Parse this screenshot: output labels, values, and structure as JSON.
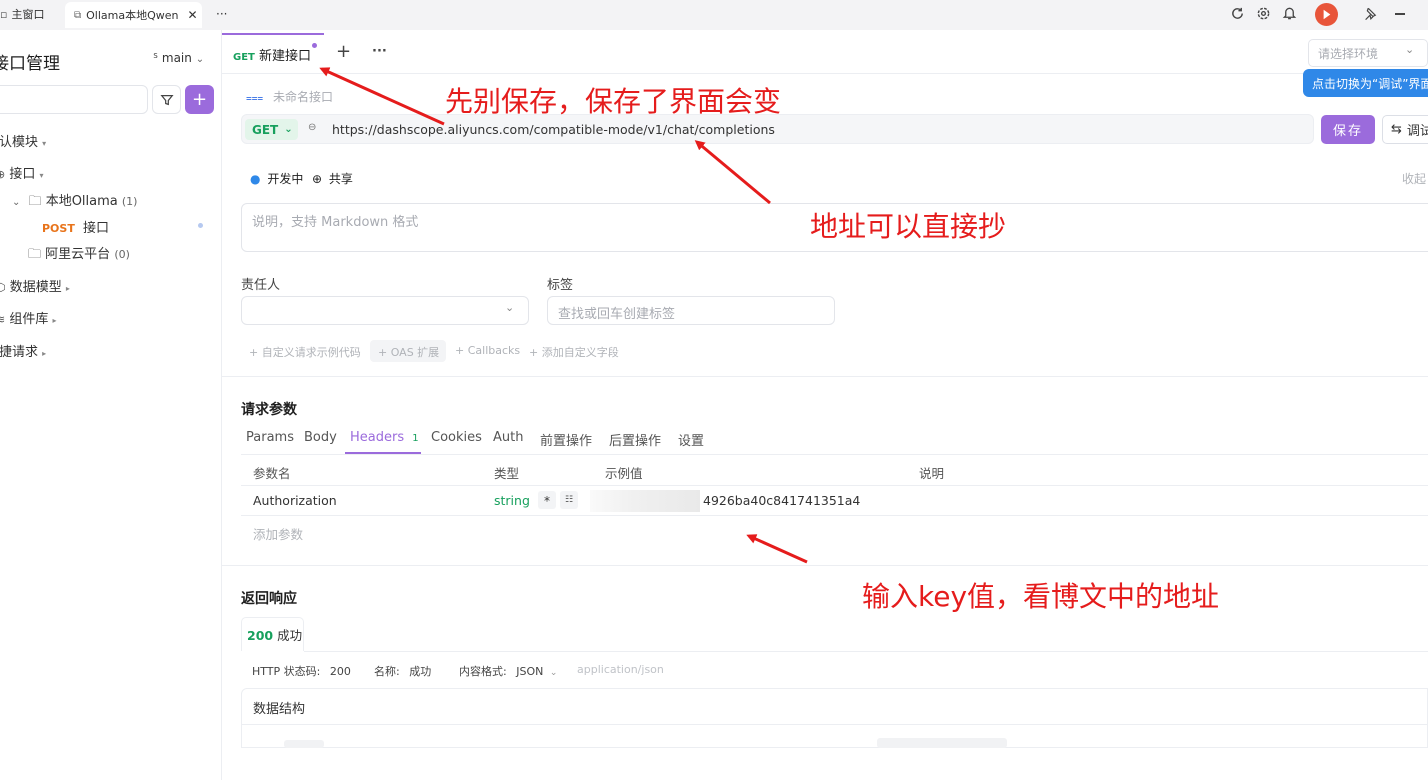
{
  "titlebar": {
    "main_window": "主窗口",
    "tab_title": "Ollama本地Qwen",
    "more": "···"
  },
  "sidebar": {
    "title": "接口管理",
    "branch": "main",
    "root_module": "默认模块",
    "api_group": "接口",
    "folder_ollama": "本地Ollama",
    "folder_ollama_count": "(1)",
    "endpoint_method": "POST",
    "endpoint_name": "接口",
    "folder_aliyun": "阿里云平台",
    "folder_aliyun_count": "(0)",
    "data_models": "数据模型",
    "components": "组件库",
    "quick_requests": "快捷请求"
  },
  "tabs": {
    "active_method": "GET",
    "active_label": "新建接口",
    "add": "+",
    "more": "···",
    "env_placeholder": "请选择环境"
  },
  "tooltip": "点击切换为“调试”界面",
  "request": {
    "name_placeholder": "未命名接口",
    "method": "GET",
    "url": "https://dashscope.aliyuncs.com/compatible-mode/v1/chat/completions",
    "save": "保存",
    "debug": "调试",
    "status": "开发中",
    "share": "共享",
    "collapse": "收起",
    "desc_placeholder": "说明，支持 Markdown 格式",
    "owner_label": "责任人",
    "tags_label": "标签",
    "tags_placeholder": "查找或回车创建标签",
    "extras": [
      "+ 自定义请求示例代码",
      "+ OAS 扩展",
      "+ Callbacks",
      "+ 添加自定义字段"
    ]
  },
  "params": {
    "title": "请求参数",
    "tabs": [
      "Params",
      "Body",
      "Headers",
      "Cookies",
      "Auth",
      "前置操作",
      "后置操作",
      "设置"
    ],
    "active_tab": "Headers",
    "headers_count": "1",
    "columns": [
      "参数名",
      "类型",
      "示例值",
      "说明"
    ],
    "rows": [
      {
        "name": "Authorization",
        "type": "string",
        "required": "*",
        "value": "4926ba40c841741351a4",
        "desc": ""
      }
    ],
    "add_param": "添加参数"
  },
  "response": {
    "title": "返回响应",
    "tab_code": "200",
    "tab_label": "成功",
    "http_status_label": "HTTP 状态码:",
    "http_status": "200",
    "name_label": "名称:",
    "name_value": "成功",
    "content_type_label": "内容格式:",
    "content_type": "JSON",
    "mime": "application/json",
    "schema_label": "数据结构"
  },
  "annotations": {
    "save_note": "先别保存，保存了界面会变",
    "url_note": "地址可以直接抄",
    "key_note": "输入key值，看博文中的地址"
  },
  "colors": {
    "accent": "#9b6bdc",
    "get_green": "#17a05d",
    "post_orange": "#e8741b",
    "annotation_red": "#e51c1c",
    "tooltip_blue": "#2f88e8"
  }
}
